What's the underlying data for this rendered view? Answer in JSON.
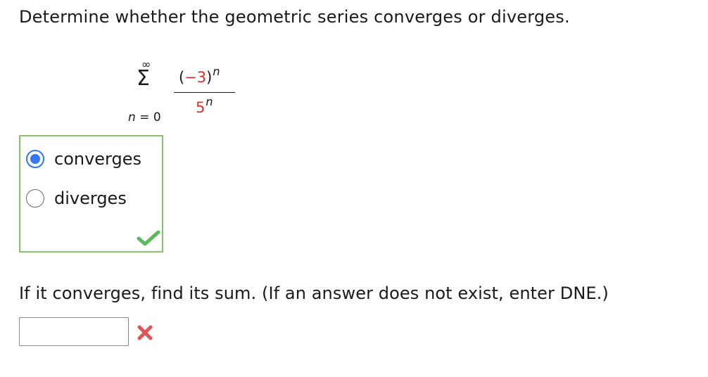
{
  "question": {
    "prompt": "Determine whether the geometric series converges or diverges."
  },
  "series": {
    "upper_limit": "∞",
    "sigma": "Σ",
    "lower_var": "n",
    "lower_eq": " = 0",
    "numerator_open": "(",
    "numerator_base": "−3",
    "numerator_close": ")",
    "numerator_exp": "n",
    "denominator_base": "5",
    "denominator_exp": "n",
    "highlight_color": "#d9342b"
  },
  "choices": {
    "options": [
      {
        "label": "converges",
        "selected": true
      },
      {
        "label": "diverges",
        "selected": false
      }
    ],
    "status_icon": "check-icon",
    "status_color": "#5cb85c",
    "border_color": "#8cbf6c"
  },
  "sum": {
    "prompt": "If it converges, find its sum. (If an answer does not exist, enter DNE.)",
    "value": "",
    "status_icon": "x-icon",
    "status_color": "#e05555"
  },
  "accent_color": "#3478f6"
}
